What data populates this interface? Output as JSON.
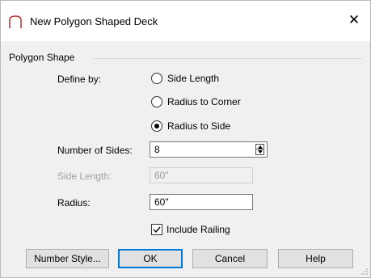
{
  "window": {
    "title": "New Polygon Shaped Deck",
    "close_glyph": "✕"
  },
  "group": {
    "label": "Polygon Shape"
  },
  "define_by": {
    "label": "Define by:",
    "options": [
      {
        "label": "Side Length",
        "selected": false
      },
      {
        "label": "Radius to Corner",
        "selected": false
      },
      {
        "label": "Radius to Side",
        "selected": true
      }
    ]
  },
  "fields": {
    "number_of_sides": {
      "label": "Number of Sides:",
      "value": "8"
    },
    "side_length": {
      "label": "Side Length:",
      "value": "60\"",
      "disabled": true
    },
    "radius": {
      "label": "Radius:",
      "value": "60\""
    }
  },
  "include_railing": {
    "label": "Include Railing",
    "checked": true
  },
  "buttons": {
    "number_style": "Number Style...",
    "ok": "OK",
    "cancel": "Cancel",
    "help": "Help"
  },
  "icons": {
    "app": "polygon-deck-icon",
    "close": "close-icon",
    "spinner": "spinner-icon",
    "check": "check-icon",
    "grip": "resize-grip-icon"
  },
  "colors": {
    "accent": "#0078d7",
    "titlebar_bg": "#ffffff",
    "dialog_bg": "#f0f0f0"
  }
}
